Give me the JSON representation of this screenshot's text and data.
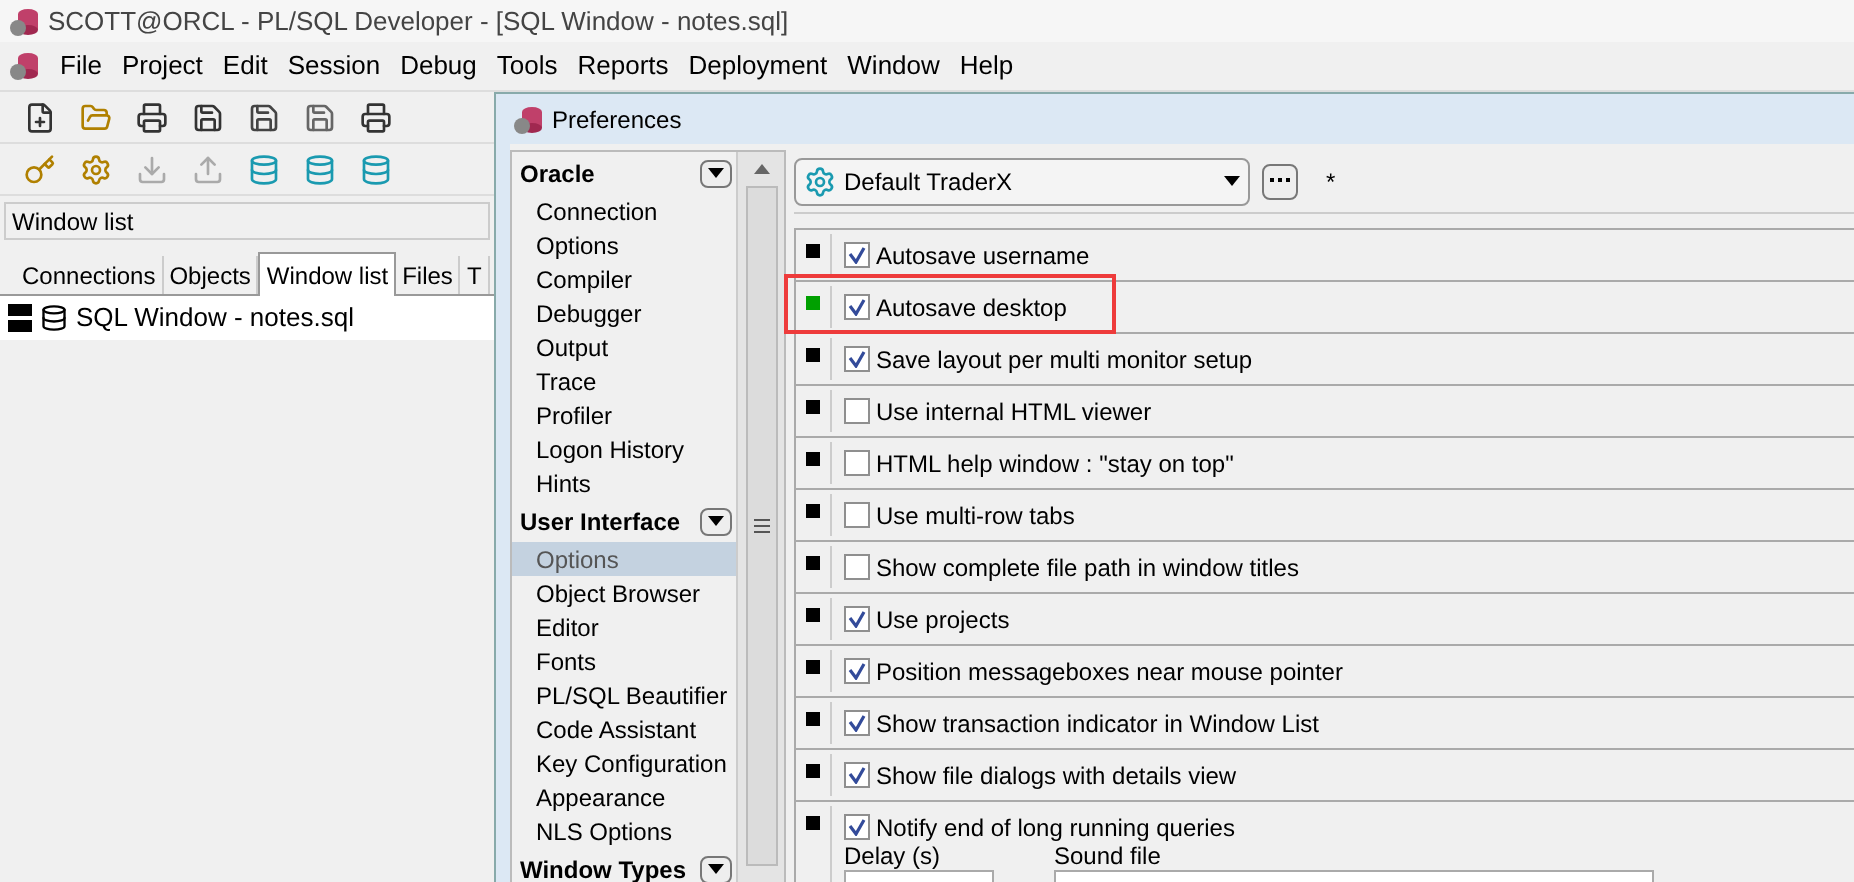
{
  "window": {
    "title": "SCOTT@ORCL - PL/SQL Developer - [SQL Window - notes.sql]"
  },
  "menu": [
    "File",
    "Project",
    "Edit",
    "Session",
    "Debug",
    "Tools",
    "Reports",
    "Deployment",
    "Window",
    "Help"
  ],
  "window_list": {
    "header": "Window list",
    "tabs": [
      {
        "label": "Connections",
        "selected": false
      },
      {
        "label": "Objects",
        "selected": false
      },
      {
        "label": "Window list",
        "selected": true
      },
      {
        "label": "Files",
        "selected": false
      },
      {
        "label": "T",
        "selected": false
      }
    ],
    "items": [
      "SQL Window - notes.sql"
    ]
  },
  "dialog": {
    "title": "Preferences",
    "nav": [
      {
        "group": "Oracle",
        "items": [
          {
            "label": "Connection",
            "selected": false
          },
          {
            "label": "Options",
            "selected": false
          },
          {
            "label": "Compiler",
            "selected": false
          },
          {
            "label": "Debugger",
            "selected": false
          },
          {
            "label": "Output",
            "selected": false
          },
          {
            "label": "Trace",
            "selected": false
          },
          {
            "label": "Profiler",
            "selected": false
          },
          {
            "label": "Logon History",
            "selected": false
          },
          {
            "label": "Hints",
            "selected": false
          }
        ]
      },
      {
        "group": "User Interface",
        "items": [
          {
            "label": "Options",
            "selected": true
          },
          {
            "label": "Object Browser",
            "selected": false
          },
          {
            "label": "Editor",
            "selected": false
          },
          {
            "label": "Fonts",
            "selected": false
          },
          {
            "label": "PL/SQL Beautifier",
            "selected": false
          },
          {
            "label": "Code Assistant",
            "selected": false
          },
          {
            "label": "Key Configuration",
            "selected": false
          },
          {
            "label": "Appearance",
            "selected": false
          },
          {
            "label": "NLS Options",
            "selected": false
          }
        ]
      },
      {
        "group": "Window Types"
      }
    ],
    "profile": {
      "value": "Default TraderX",
      "modified": "*"
    },
    "options": [
      {
        "label": "Autosave username",
        "checked": true,
        "color": "#000000",
        "highlighted": false
      },
      {
        "label": "Autosave desktop",
        "checked": true,
        "color": "#00a000",
        "highlighted": true
      },
      {
        "label": "Save layout per multi monitor setup",
        "checked": true,
        "color": "#000000",
        "highlighted": false
      },
      {
        "label": "Use internal HTML viewer",
        "checked": false,
        "color": "#000000",
        "highlighted": false
      },
      {
        "label": "HTML help window : \"stay on top\"",
        "checked": false,
        "color": "#000000",
        "highlighted": false
      },
      {
        "label": "Use multi-row tabs",
        "checked": false,
        "color": "#000000",
        "highlighted": false
      },
      {
        "label": "Show complete file path in window titles",
        "checked": false,
        "color": "#000000",
        "highlighted": false
      },
      {
        "label": "Use projects",
        "checked": true,
        "color": "#000000",
        "highlighted": false
      },
      {
        "label": "Position messageboxes near mouse pointer",
        "checked": true,
        "color": "#000000",
        "highlighted": false
      },
      {
        "label": "Show transaction indicator in Window List",
        "checked": true,
        "color": "#000000",
        "highlighted": false
      },
      {
        "label": "Show file dialogs with details view",
        "checked": true,
        "color": "#000000",
        "highlighted": false
      },
      {
        "label": "Notify end of long running queries",
        "checked": true,
        "color": "#000000",
        "highlighted": false,
        "fields": [
          "Delay (s)",
          "Sound file"
        ]
      }
    ]
  }
}
